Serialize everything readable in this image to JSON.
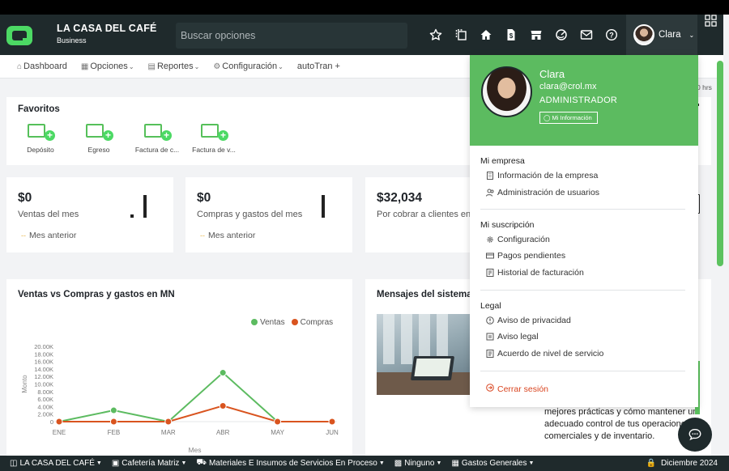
{
  "header": {
    "business_name": "LA CASA DEL CAFÉ",
    "plan": "Business",
    "search_placeholder": "Buscar opciones",
    "user_name": "Clara",
    "icons": [
      "star-icon",
      "copy-icon",
      "home-icon",
      "document-dollar-icon",
      "store-icon",
      "chart-pie-icon",
      "mail-icon",
      "help-icon"
    ]
  },
  "menu": {
    "items": [
      {
        "label": "Dashboard",
        "icon": "home-icon"
      },
      {
        "label": "Opciones",
        "icon": "calendar-icon"
      },
      {
        "label": "Reportes",
        "icon": "report-icon"
      },
      {
        "label": "Configuración",
        "icon": "gear-icon"
      },
      {
        "label": "autoTran +",
        "icon": ""
      }
    ]
  },
  "favorites": {
    "title": "Favoritos",
    "items": [
      {
        "label": "Depósito"
      },
      {
        "label": "Egreso"
      },
      {
        "label": "Factura de c..."
      },
      {
        "label": "Factura de v..."
      }
    ]
  },
  "stats": [
    {
      "amount": "$0",
      "label": "Ventas del mes",
      "prev": "Mes anterior"
    },
    {
      "amount": "$0",
      "label": "Compras y gastos del mes",
      "prev": "Mes anterior"
    },
    {
      "amount": "$32,034",
      "label": "Por cobrar a clientes en M"
    }
  ],
  "side_hours": "0 hrs",
  "chart_card": {
    "title": "Ventas vs Compras y gastos en MN"
  },
  "chart_data": {
    "type": "line",
    "title": "Ventas vs Compras y gastos en MN",
    "xlabel": "Mes",
    "ylabel": "Monto",
    "categories": [
      "ENE",
      "FEB",
      "MAR",
      "ABR",
      "MAY",
      "JUN"
    ],
    "y_ticks": [
      "0",
      "2.00K",
      "4.00K",
      "6.00K",
      "8.00K",
      "10.00K",
      "12.00K",
      "14.00K",
      "16.00K",
      "18.00K",
      "20.00K"
    ],
    "ylim": [
      0,
      20000
    ],
    "series": [
      {
        "name": "Ventas",
        "color": "#5cbb60",
        "values": [
          0,
          3000,
          0,
          13000,
          0,
          0
        ]
      },
      {
        "name": "Compras",
        "color": "#d9541f",
        "values": [
          0,
          0,
          0,
          4200,
          0,
          0
        ]
      }
    ],
    "legend_position": "top-right",
    "grid": false
  },
  "messages": {
    "title": "Mensajes del sistema",
    "text": "mejores prácticas y cómo mantener un adecuado control de tus operaciones comerciales y de inventario."
  },
  "dropdown": {
    "name": "Clara",
    "email": "clara@crol.mx",
    "role": "ADMINISTRADOR",
    "info_button": "Mi Información",
    "sections": [
      {
        "title": "Mi empresa",
        "items": [
          {
            "label": "Información de la empresa",
            "icon": "building-icon"
          },
          {
            "label": "Administración de usuarios",
            "icon": "users-icon"
          }
        ]
      },
      {
        "title": "Mi suscripción",
        "items": [
          {
            "label": "Configuración",
            "icon": "gear-icon"
          },
          {
            "label": "Pagos pendientes",
            "icon": "receipt-icon"
          },
          {
            "label": "Historial de facturación",
            "icon": "invoice-icon"
          }
        ]
      },
      {
        "title": "Legal",
        "items": [
          {
            "label": "Aviso de privacidad",
            "icon": "info-icon"
          },
          {
            "label": "Aviso legal",
            "icon": "legal-icon"
          },
          {
            "label": "Acuerdo de nivel de servicio",
            "icon": "contract-icon"
          }
        ]
      }
    ],
    "logout": "Cerrar sesión"
  },
  "statusbar": {
    "items": [
      {
        "label": "LA CASA DEL CAFÉ",
        "icon": "car-icon"
      },
      {
        "label": "Cafetería Matriz",
        "icon": "terminal-icon"
      },
      {
        "label": "Materiales E Insumos de Servicios En Proceso",
        "icon": "truck-icon"
      },
      {
        "label": "Ninguno",
        "icon": "folder-icon"
      },
      {
        "label": "Gastos Generales",
        "icon": "table-icon"
      }
    ],
    "period": "Diciembre 2024"
  }
}
